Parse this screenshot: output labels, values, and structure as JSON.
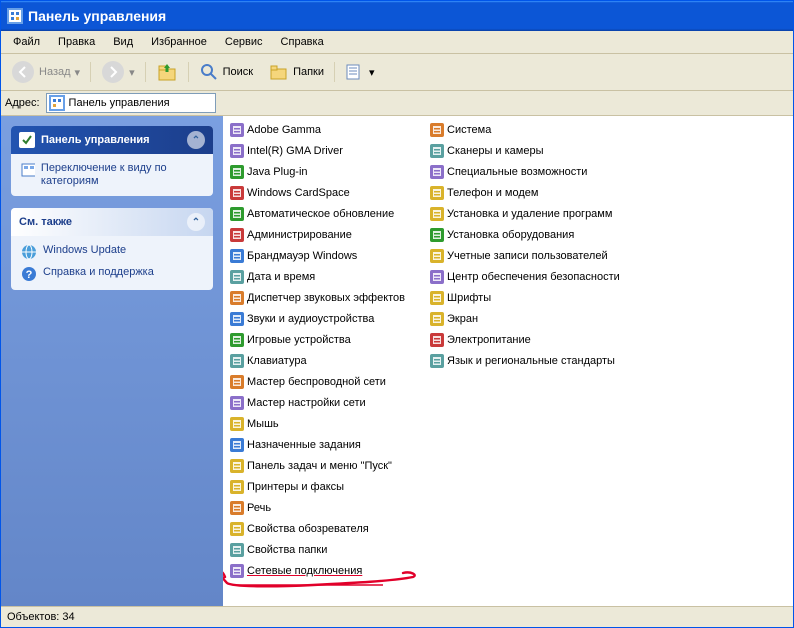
{
  "title": "Панель управления",
  "menu": [
    "Файл",
    "Правка",
    "Вид",
    "Избранное",
    "Сервис",
    "Справка"
  ],
  "toolbar": {
    "back": "Назад",
    "search": "Поиск",
    "folders": "Папки"
  },
  "address": {
    "label": "Адрес:",
    "value": "Панель управления"
  },
  "side_panel1": {
    "title": "Панель управления",
    "link": "Переключение к виду по категориям"
  },
  "side_panel2": {
    "title": "См. также",
    "link1": "Windows Update",
    "link2": "Справка и поддержка"
  },
  "col1": [
    "Adobe Gamma",
    "Intel(R) GMA Driver",
    "Java Plug-in",
    "Windows CardSpace",
    "Автоматическое обновление",
    "Администрирование",
    "Брандмауэр Windows",
    "Дата и время",
    "Диспетчер звуковых эффектов",
    "Звуки и аудиоустройства",
    "Игровые устройства",
    "Клавиатура",
    "Мастер беспроводной сети",
    "Мастер настройки сети",
    "Мышь",
    "Назначенные задания",
    "Панель задач и меню \"Пуск\"",
    "Принтеры и факсы",
    "Речь",
    "Свойства обозревателя",
    "Свойства папки",
    "Сетевые подключения"
  ],
  "col2": [
    "Система",
    "Сканеры и камеры",
    "Специальные возможности",
    "Телефон и модем",
    "Установка и удаление программ",
    "Установка оборудования",
    "Учетные записи пользователей",
    "Центр обеспечения безопасности",
    "Шрифты",
    "Экран",
    "Электропитание",
    "Язык и региональные стандарты"
  ],
  "status": "Объектов: 34"
}
